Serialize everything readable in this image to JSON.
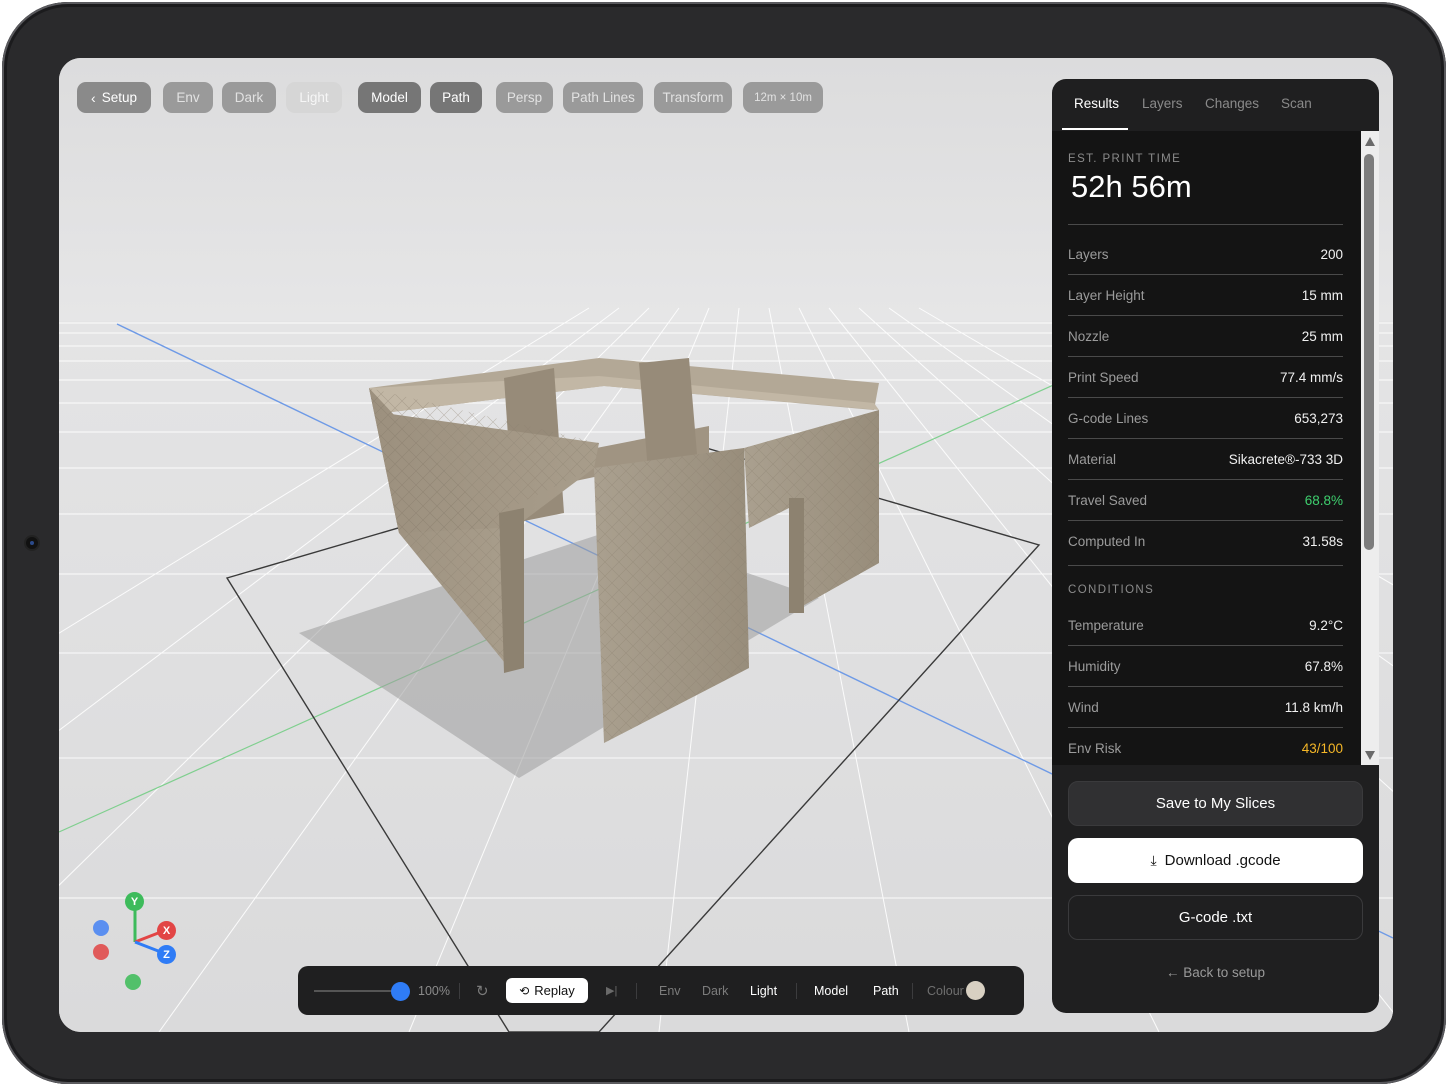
{
  "toolbar": {
    "setup": "Setup",
    "env": "Env",
    "dark": "Dark",
    "light": "Light",
    "model": "Model",
    "path": "Path",
    "persp": "Persp",
    "path_lines": "Path Lines",
    "transform": "Transform",
    "size": "12m × 10m"
  },
  "bottombar": {
    "speed": "100%",
    "speed_fraction": 1.0,
    "replay": "Replay",
    "env": "Env",
    "dark": "Dark",
    "light": "Light",
    "model": "Model",
    "path": "Path",
    "colour": "Colour",
    "colour_swatch": "#d8d0c2"
  },
  "gizmo": {
    "y": "Y",
    "x": "X",
    "z": "Z"
  },
  "panel": {
    "tabs": [
      "Results",
      "Layers",
      "Changes",
      "Scan"
    ],
    "active_tab": "Results",
    "print_time_label": "EST. PRINT TIME",
    "print_time": "52h 56m",
    "stats": [
      {
        "label": "Layers",
        "value": "200"
      },
      {
        "label": "Layer Height",
        "value": "15 mm"
      },
      {
        "label": "Nozzle",
        "value": "25 mm"
      },
      {
        "label": "Print Speed",
        "value": "77.4 mm/s"
      },
      {
        "label": "G-code Lines",
        "value": "653,273"
      },
      {
        "label": "Material",
        "value": "Sikacrete®-733 3D"
      },
      {
        "label": "Travel Saved",
        "value": "68.8%"
      },
      {
        "label": "Computed In",
        "value": "31.58s"
      }
    ],
    "conditions_label": "CONDITIONS",
    "conditions": [
      {
        "label": "Temperature",
        "value": "9.2°C"
      },
      {
        "label": "Humidity",
        "value": "67.8%"
      },
      {
        "label": "Wind",
        "value": "11.8 km/h"
      },
      {
        "label": "Env Risk",
        "value": "43/100"
      }
    ],
    "save_button": "Save to My Slices",
    "download_button": "Download .gcode",
    "txt_button": "G-code .txt",
    "back_link": "← Back to setup"
  },
  "colors": {
    "accent": "#2f7cf6",
    "success": "#3ecf6e",
    "warning": "#f5b727",
    "model": "#a59a88"
  }
}
